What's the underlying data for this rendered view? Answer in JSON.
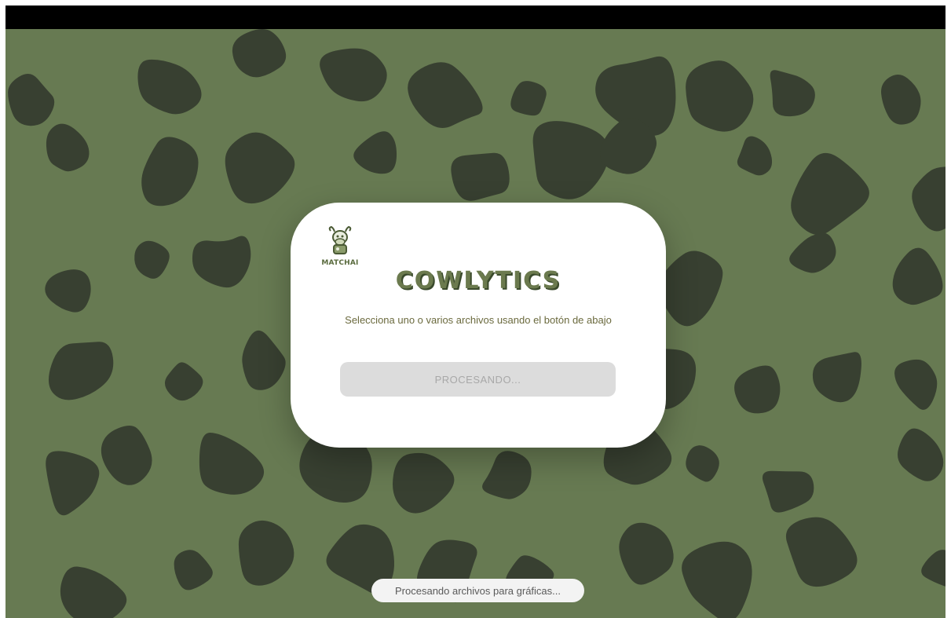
{
  "colors": {
    "background": "#677a52",
    "spots": "#384031",
    "card": "#ffffff",
    "accent": "#6b7a4e",
    "title_shadow": "#3a4a2c",
    "button_bg": "#dcdcdc",
    "button_text": "#a8a8a8"
  },
  "logo": {
    "text": "MATCHAI",
    "icon": "cow-icon"
  },
  "card": {
    "title": "COWLYTICS",
    "subtitle": "Selecciona uno o varios archivos usando el botón de abajo",
    "button_label": "PROCESANDO..."
  },
  "toast": {
    "text": "Procesando archivos para gráficas..."
  }
}
